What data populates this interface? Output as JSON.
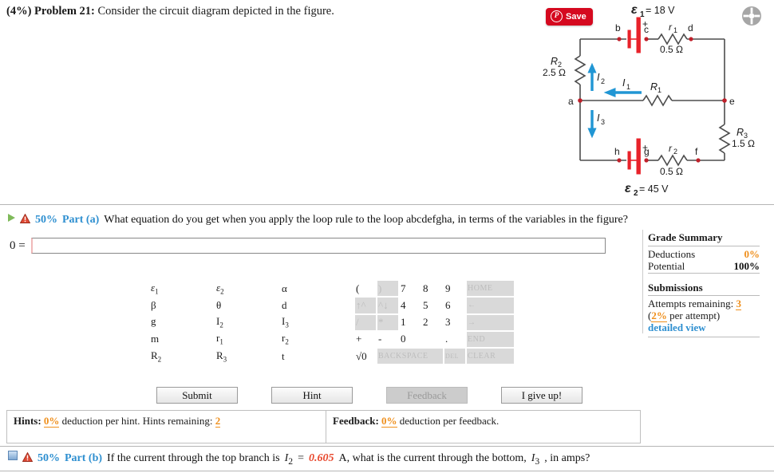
{
  "problem": {
    "weight": "(4%)",
    "label": "Problem 21:",
    "statement": "Consider the circuit diagram depicted in the figure."
  },
  "figure": {
    "save_button_label": "Save",
    "save_icon": "pinterest-icon",
    "expand_icon": "expand-figure-icon",
    "emf1_label": "ε1",
    "emf1_value": "= 18 V",
    "emf2_label": "ε2",
    "emf2_value": "= 45 V",
    "nodes": [
      "a",
      "b",
      "c",
      "d",
      "e",
      "f",
      "g",
      "h"
    ],
    "components": [
      {
        "name": "R2",
        "symbol": "R",
        "sub": "2",
        "value": "2.5 Ω"
      },
      {
        "name": "R1",
        "symbol": "R",
        "sub": "1",
        "value": ""
      },
      {
        "name": "R3",
        "symbol": "R",
        "sub": "3",
        "value": "1.5 Ω"
      },
      {
        "name": "r1",
        "symbol": "r",
        "sub": "1",
        "value": "0.5 Ω"
      },
      {
        "name": "r2",
        "symbol": "r",
        "sub": "2",
        "value": "0.5 Ω"
      }
    ],
    "currents": [
      {
        "name": "I1",
        "symbol": "I",
        "sub": "1",
        "direction": "left"
      },
      {
        "name": "I2",
        "symbol": "I",
        "sub": "2",
        "direction": "up"
      },
      {
        "name": "I3",
        "symbol": "I",
        "sub": "3",
        "direction": "down"
      }
    ],
    "plus_signs": 2,
    "wire_color": "#4d4d4d",
    "battery_color": "#e8222a",
    "node_color": "#c0202a",
    "current_color": "#2196d4"
  },
  "part_a": {
    "percent": "50%",
    "name": "Part (a)",
    "question": "What equation do you get when you apply the loop rule to the loop abcdefgha, in terms of the variables in the figure?",
    "toggle_icon": "expand-triangle-icon",
    "warn_icon": "warning-triangle-icon",
    "answer_prefix": "0 =",
    "answer_value": "",
    "answer_placeholder": ""
  },
  "grade_summary": {
    "title": "Grade Summary",
    "rows": [
      {
        "label": "Deductions",
        "value": "0%",
        "style": "orange"
      },
      {
        "label": "Potential",
        "value": "100%",
        "style": "black"
      }
    ],
    "submissions_title": "Submissions",
    "attempts_label": "Attempts remaining:",
    "attempts_value": "3",
    "per_attempt_value": "2%",
    "per_attempt_suffix": " per attempt)",
    "per_attempt_prefix": "(",
    "detailed_view": "detailed view"
  },
  "keypad": {
    "left_rows": [
      [
        {
          "t": "ε",
          "sub": "1",
          "cls": "eps"
        },
        {
          "t": "ε",
          "sub": "2",
          "cls": "eps"
        },
        {
          "t": "α"
        }
      ],
      [
        {
          "t": "β"
        },
        {
          "t": "θ"
        },
        {
          "t": "d"
        }
      ],
      [
        {
          "t": "g"
        },
        {
          "t": "I",
          "sub": "2"
        },
        {
          "t": "I",
          "sub": "3"
        }
      ],
      [
        {
          "t": "m"
        },
        {
          "t": "r",
          "sub": "1"
        },
        {
          "t": "r",
          "sub": "2"
        }
      ],
      [
        {
          "t": "R",
          "sub": "2"
        },
        {
          "t": "R",
          "sub": "3"
        },
        {
          "t": "t"
        }
      ]
    ],
    "right_rows": [
      [
        {
          "t": "(",
          "k": "num"
        },
        {
          "t": ")",
          "k": "dis"
        },
        {
          "t": "7",
          "k": "num"
        },
        {
          "t": "8",
          "k": "num"
        },
        {
          "t": "9",
          "k": "num"
        },
        {
          "t": "HOME",
          "k": "navdis"
        }
      ],
      [
        {
          "t": "↑^",
          "k": "dis"
        },
        {
          "t": "^↓",
          "k": "dis"
        },
        {
          "t": "4",
          "k": "num"
        },
        {
          "t": "5",
          "k": "num"
        },
        {
          "t": "6",
          "k": "num"
        },
        {
          "t": "←",
          "k": "navdis"
        }
      ],
      [
        {
          "t": "/",
          "k": "dis"
        },
        {
          "t": "*",
          "k": "dis"
        },
        {
          "t": "1",
          "k": "num"
        },
        {
          "t": "2",
          "k": "num"
        },
        {
          "t": "3",
          "k": "num"
        },
        {
          "t": "→",
          "k": "navdis"
        }
      ],
      [
        {
          "t": "+",
          "k": "num"
        },
        {
          "t": "-",
          "k": "num"
        },
        {
          "t": "0",
          "k": "wide2"
        },
        {
          "t": ".",
          "k": "num"
        },
        {
          "t": "END",
          "k": "navdis"
        }
      ],
      [
        {
          "t": "√0",
          "k": "num"
        },
        {
          "t": "BACKSPACE",
          "k": "bksp"
        },
        {
          "t": "DEL",
          "k": "del"
        },
        {
          "t": "CLEAR",
          "k": "navdis"
        }
      ]
    ]
  },
  "actions": {
    "submit": "Submit",
    "hint": "Hint",
    "feedback": "Feedback",
    "give_up": "I give up!"
  },
  "hint_bar": {
    "hints_label": "Hints:",
    "hints_deduction": "0%",
    "hints_text": " deduction per hint. Hints remaining:",
    "hints_remaining": "2",
    "feedback_label": "Feedback:",
    "feedback_deduction": "0%",
    "feedback_text": " deduction per feedback."
  },
  "part_b": {
    "percent": "50%",
    "name": "Part (b)",
    "toggle_icon": "collapsed-square-icon",
    "warn_icon": "warning-triangle-icon",
    "text_1": "If the current through the top branch is",
    "var_1": "I",
    "var_1_sub": "2",
    "eq": "=",
    "value": "0.605",
    "text_2": "A, what is the current through the bottom,",
    "var_2": "I",
    "var_2_sub": "3",
    "text_3": ", in amps?"
  }
}
